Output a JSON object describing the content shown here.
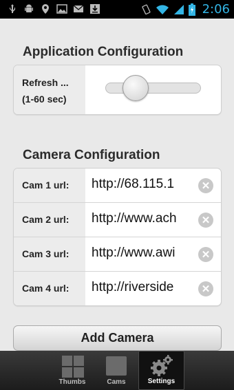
{
  "statusbar": {
    "time": "2:06"
  },
  "app_config": {
    "title": "Application Configuration",
    "refresh_label_line1": "Refresh ...",
    "refresh_label_line2": "(1-60 sec)"
  },
  "camera_config": {
    "title": "Camera Configuration",
    "cams": [
      {
        "label": "Cam 1 url:",
        "url": "http://68.115.1"
      },
      {
        "label": "Cam 2 url:",
        "url": "http://www.ach"
      },
      {
        "label": "Cam 3 url:",
        "url": "http://www.awi"
      },
      {
        "label": "Cam 4 url:",
        "url": "http://riverside"
      }
    ],
    "add_button": "Add Camera"
  },
  "tabs": [
    {
      "label": "Thumbs",
      "active": false
    },
    {
      "label": "Cams",
      "active": false
    },
    {
      "label": "Settings",
      "active": true
    }
  ],
  "colors": {
    "clock": "#33b5e5",
    "background": "#e9e9e9"
  }
}
